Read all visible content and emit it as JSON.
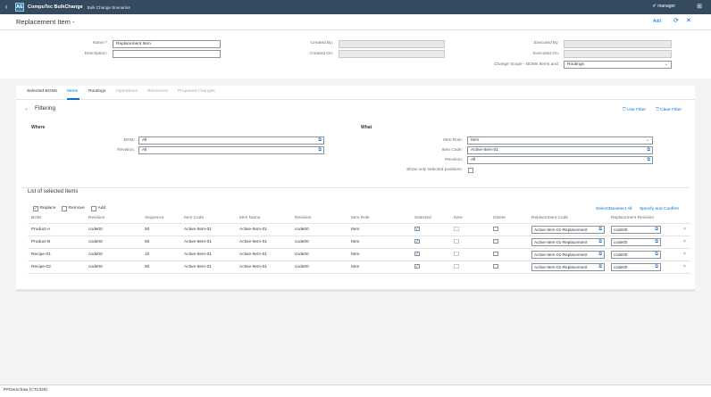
{
  "shell": {
    "logo": "AE",
    "app_name": "CompuTec BulkChange",
    "app_sub": "Bulk Change Scenarios",
    "user": "manager"
  },
  "header": {
    "title": "Replacement Item -",
    "add": "Add"
  },
  "form": {
    "name_label": "Name:*",
    "name_value": "Replacement Item",
    "description_label": "Description:",
    "description_value": "",
    "created_by_label": "Created By:",
    "created_on_label": "Created On:",
    "executed_by_label": "Executed By:",
    "executed_on_label": "Executed On:",
    "change_scope_label": "Change Scope - BOMs Items and:",
    "change_scope_value": "Routings"
  },
  "tabs": [
    "Selected BOMs",
    "Items",
    "Routings",
    "Operations",
    "Resources",
    "Proposed Changes"
  ],
  "filtering": {
    "title": "Filtering",
    "use_filter": "Use Filter",
    "clear_filter": "Clear Filter",
    "where": "Where",
    "what": "What",
    "bom_label": "BOM:",
    "bom_value": "All",
    "revision_label": "Revision:",
    "revision_value": "All",
    "item_role_label": "Item Role:",
    "item_role_value": "Item",
    "item_code_label": "Item Code:",
    "item_code_value": "Active-Item-01",
    "what_revision_label": "Revision:",
    "what_revision_value": "All",
    "show_only_label": "Show only selected positions:"
  },
  "list": {
    "title": "List of selected Items",
    "replace": "Replace",
    "remove": "Remove",
    "add": "Add",
    "select_deselect": "Select/Deselect All",
    "specify_confirm": "Specify and Confirm",
    "columns": [
      "BOM",
      "Revision",
      "Sequence",
      "Item Code",
      "Item Name",
      "Revision",
      "Item Role",
      "Selected",
      "New",
      "Delete",
      "Replacement Code",
      "Replacement Revision"
    ],
    "rows": [
      {
        "bom": "Product-A",
        "revision": "code00",
        "sequence": "50",
        "item_code": "Active-Item-01",
        "item_name": "Active-Item-01",
        "item_revision": "code00",
        "item_role": "Item",
        "repl_code": "Active-Item-01-Replacement",
        "repl_rev": "code00"
      },
      {
        "bom": "Product-B",
        "revision": "code00",
        "sequence": "50",
        "item_code": "Active-Item-01",
        "item_name": "Active-Item-01",
        "item_revision": "code00",
        "item_role": "Item",
        "repl_code": "Active-Item-01-Replacement",
        "repl_rev": "code00"
      },
      {
        "bom": "Recipe-01",
        "revision": "code00",
        "sequence": "10",
        "item_code": "Active-Item-01",
        "item_name": "Active-Item-01",
        "item_revision": "code00",
        "item_role": "Item",
        "repl_code": "Active-Item-01-Replacement",
        "repl_rev": "code00"
      },
      {
        "bom": "Recipe-02",
        "revision": "code00",
        "sequence": "50",
        "item_code": "Active-Item-01",
        "item_name": "Active-Item-01",
        "item_revision": "code00",
        "item_role": "Item",
        "repl_code": "Active-Item-01-Replacement",
        "repl_rev": "code00"
      }
    ]
  },
  "footer": {
    "status": "PFDemchaw (CTL028)"
  }
}
